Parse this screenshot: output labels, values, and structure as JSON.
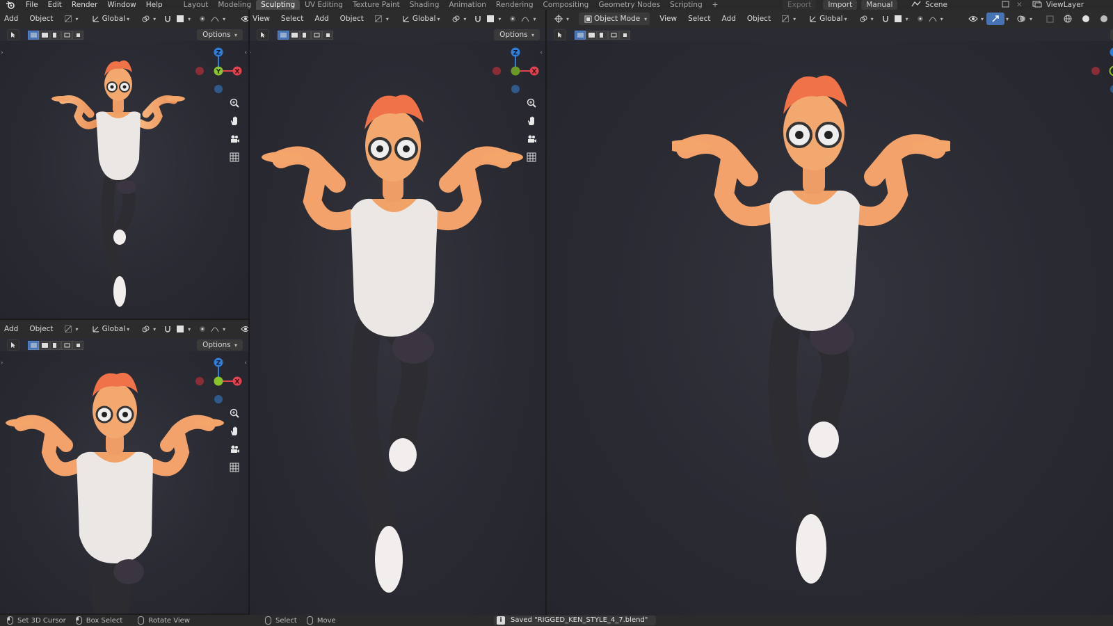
{
  "topbar": {
    "menus": [
      "File",
      "Edit",
      "Render",
      "Window",
      "Help"
    ],
    "workspaces": [
      "Layout",
      "Modeling",
      "Sculpting",
      "UV Editing",
      "Texture Paint",
      "Shading",
      "Animation",
      "Rendering",
      "Compositing",
      "Geometry Nodes",
      "Scripting"
    ],
    "active_workspace": "Sculpting",
    "add_tab": "+",
    "export_label": "Export",
    "import_label": "Import",
    "manual_label": "Manual",
    "scene_label": "Scene",
    "viewlayer_label": "ViewLayer"
  },
  "viewports": {
    "top_left": {
      "add": "Add",
      "object": "Object",
      "transform": "Global",
      "options": "Options"
    },
    "bottom_left": {
      "add": "Add",
      "object": "Object",
      "transform": "Global",
      "options": "Options"
    },
    "middle": {
      "view": "View",
      "select": "Select",
      "add": "Add",
      "object": "Object",
      "transform": "Global",
      "options": "Options"
    },
    "right": {
      "mode": "Object Mode",
      "view": "View",
      "select": "Select",
      "add": "Add",
      "object": "Object",
      "transform": "Global",
      "options_partial": "O"
    }
  },
  "gizmo": {
    "z": "Z",
    "y": "Y",
    "x": "X"
  },
  "colors": {
    "accent": "#4772b3",
    "axis_x": "#e0424f",
    "axis_y": "#8bc32c",
    "axis_z": "#2f7fd8",
    "hair": "#f0744d",
    "skin": "#f3a56b",
    "tank": "#e9e6e3",
    "pants": "#2a2a2f"
  },
  "statusbar": {
    "set_cursor": "Set 3D Cursor",
    "box_select": "Box Select",
    "rotate_view": "Rotate View",
    "select": "Select",
    "move": "Move",
    "saved_message": "Saved \"RIGGED_KEN_STYLE_4_7.blend\""
  }
}
